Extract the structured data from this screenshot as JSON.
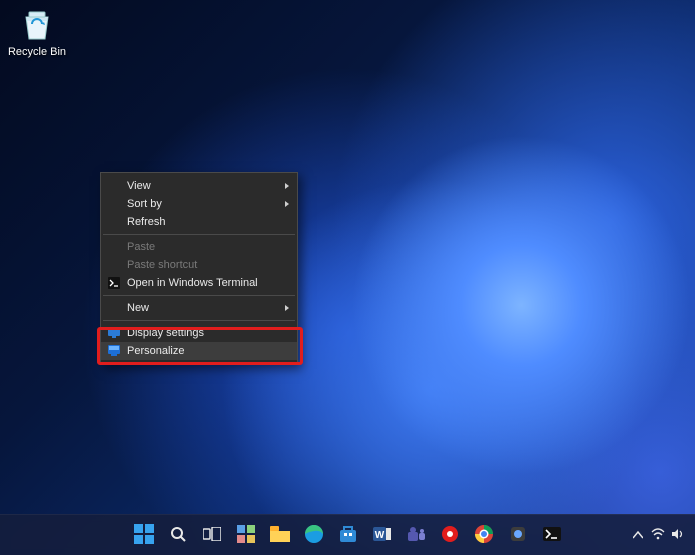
{
  "desktop": {
    "icons": [
      {
        "name": "recycle-bin",
        "label": "Recycle Bin"
      }
    ]
  },
  "context_menu": {
    "items": [
      {
        "key": "view",
        "label": "View",
        "submenu": true
      },
      {
        "key": "sortby",
        "label": "Sort by",
        "submenu": true
      },
      {
        "key": "refresh",
        "label": "Refresh"
      },
      {
        "sep": true
      },
      {
        "key": "paste",
        "label": "Paste",
        "disabled": true
      },
      {
        "key": "pastesc",
        "label": "Paste shortcut",
        "disabled": true
      },
      {
        "key": "terminal",
        "label": "Open in Windows Terminal",
        "icon": "terminal-icon"
      },
      {
        "sep": true
      },
      {
        "key": "new",
        "label": "New",
        "submenu": true
      },
      {
        "sep": true
      },
      {
        "key": "display",
        "label": "Display settings",
        "icon": "display-icon"
      },
      {
        "key": "personalize",
        "label": "Personalize",
        "icon": "personalize-icon",
        "hovered": true
      }
    ]
  },
  "highlight_target": "personalize",
  "taskbar": {
    "center_items": [
      "start-icon",
      "search-icon",
      "taskview-icon",
      "widgets-icon",
      "explorer-icon",
      "edge-icon",
      "store-icon",
      "word-icon",
      "teams-icon",
      "record-icon",
      "chrome-icon",
      "app-icon",
      "terminal-icon"
    ],
    "tray_items": [
      "chevron-up-icon",
      "wifi-icon",
      "volume-icon"
    ]
  },
  "colors": {
    "highlight": "#e11d1d",
    "menu_bg": "#2b2b2b",
    "menu_fg": "#eaeaea"
  }
}
